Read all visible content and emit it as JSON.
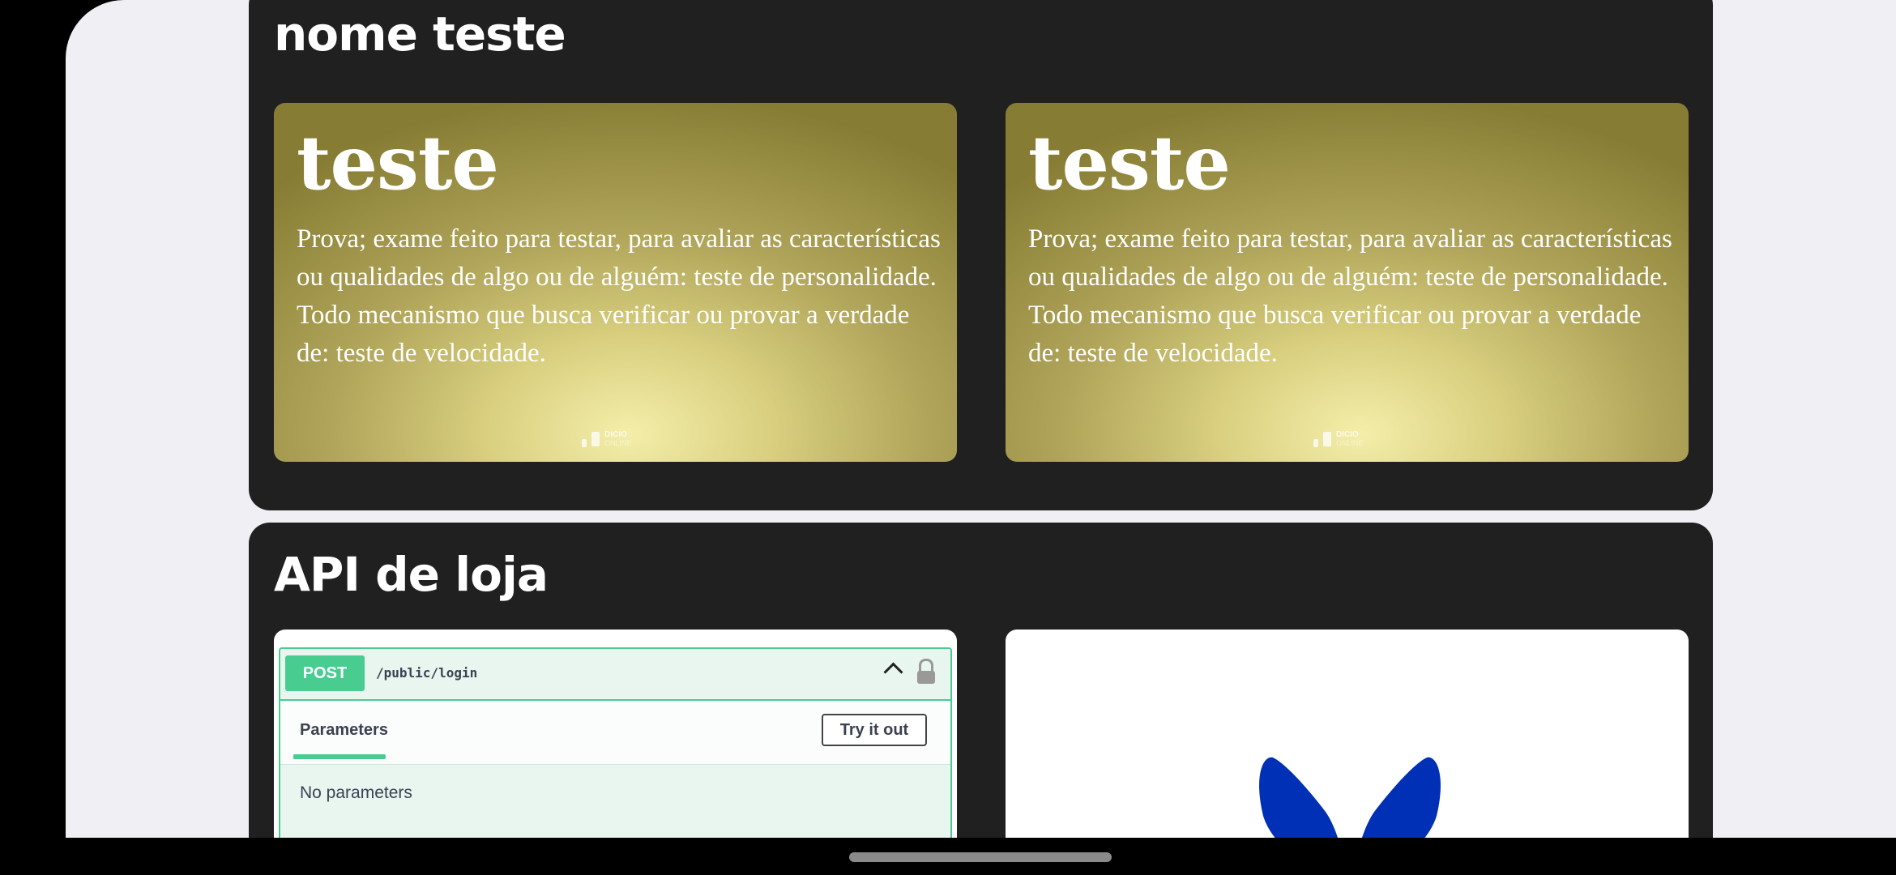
{
  "projects": [
    {
      "title": "nome teste",
      "tiles": [
        {
          "word": "teste",
          "definition": [
            "Prova; exame feito para testar, para avaliar as características ou qualidades de algo ou de alguém: teste de personalidade.",
            "Todo mecanismo que busca verificar ou provar a verdade de: teste de velocidade."
          ],
          "brand_name": "DICIO",
          "brand_sub": "ONLINE"
        },
        {
          "word": "teste",
          "definition": [
            "Prova; exame feito para testar, para avaliar as características ou qualidades de algo ou de alguém: teste de personalidade.",
            "Todo mecanismo que busca verificar ou provar a verdade de: teste de velocidade."
          ],
          "brand_name": "DICIO",
          "brand_sub": "ONLINE"
        }
      ]
    },
    {
      "title": "API de loja",
      "swagger": {
        "method": "POST",
        "path": "/public/login",
        "tab_label": "Parameters",
        "try_button": "Try it out",
        "empty_text": "No parameters"
      },
      "logo_icon": "blue-wings-logo",
      "logo_color": "#0030b5"
    }
  ],
  "colors": {
    "card_bg": "#202020",
    "page_bg": "#f0eff4",
    "swagger_green": "#49cc90"
  }
}
